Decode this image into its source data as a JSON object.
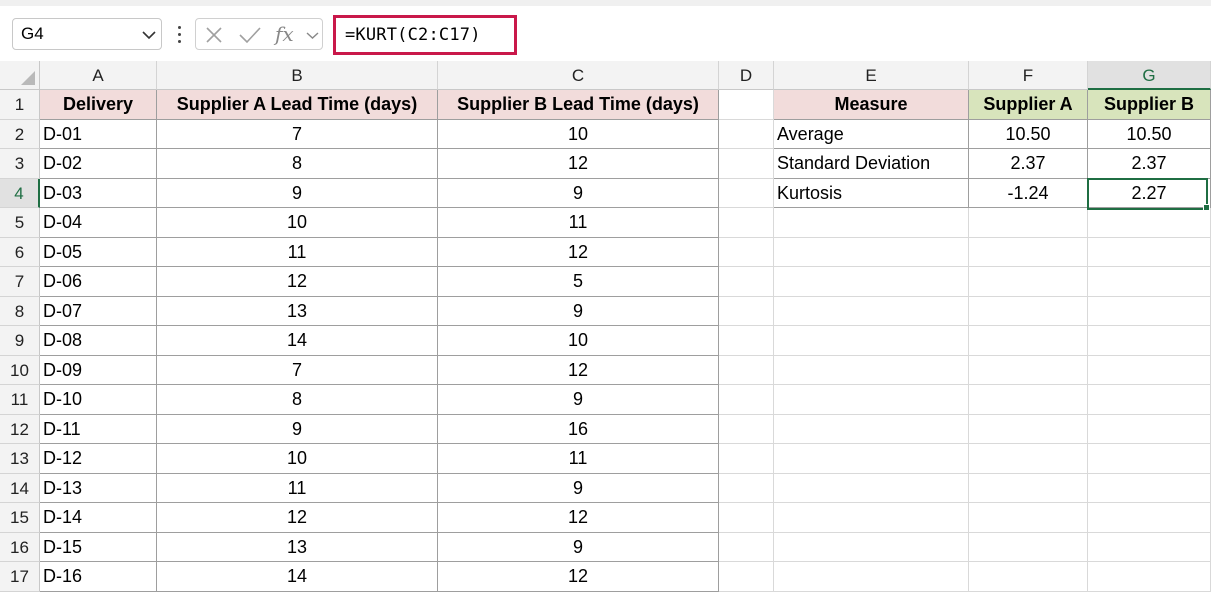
{
  "name_box": {
    "value": "G4"
  },
  "formula_bar": {
    "cancel_icon": "x-icon",
    "enter_icon": "check-icon",
    "fx_label": "fx",
    "formula": "=KURT(C2:C17)"
  },
  "columns": [
    "A",
    "B",
    "C",
    "D",
    "E",
    "F",
    "G"
  ],
  "rows": [
    "1",
    "2",
    "3",
    "4",
    "5",
    "6",
    "7",
    "8",
    "9",
    "10",
    "11",
    "12",
    "13",
    "14",
    "15",
    "16",
    "17"
  ],
  "selected_cell": "G4",
  "main_table": {
    "headers": [
      "Delivery",
      "Supplier A Lead Time (days)",
      "Supplier B Lead Time (days)"
    ],
    "rows": [
      [
        "D-01",
        "7",
        "10"
      ],
      [
        "D-02",
        "8",
        "12"
      ],
      [
        "D-03",
        "9",
        "9"
      ],
      [
        "D-04",
        "10",
        "11"
      ],
      [
        "D-05",
        "11",
        "12"
      ],
      [
        "D-06",
        "12",
        "5"
      ],
      [
        "D-07",
        "13",
        "9"
      ],
      [
        "D-08",
        "14",
        "10"
      ],
      [
        "D-09",
        "7",
        "12"
      ],
      [
        "D-10",
        "8",
        "9"
      ],
      [
        "D-11",
        "9",
        "16"
      ],
      [
        "D-12",
        "10",
        "11"
      ],
      [
        "D-13",
        "11",
        "9"
      ],
      [
        "D-14",
        "12",
        "12"
      ],
      [
        "D-15",
        "13",
        "9"
      ],
      [
        "D-16",
        "14",
        "12"
      ]
    ]
  },
  "summary_table": {
    "headers": [
      "Measure",
      "Supplier A",
      "Supplier B"
    ],
    "rows": [
      [
        "Average",
        "10.50",
        "10.50"
      ],
      [
        "Standard Deviation",
        "2.37",
        "2.37"
      ],
      [
        "Kurtosis",
        "-1.24",
        "2.27"
      ]
    ]
  },
  "colors": {
    "pink_header": "#f2dcdb",
    "green_header": "#d8e4bc",
    "selection": "#1f6e43",
    "formula_highlight": "#c9184a"
  }
}
